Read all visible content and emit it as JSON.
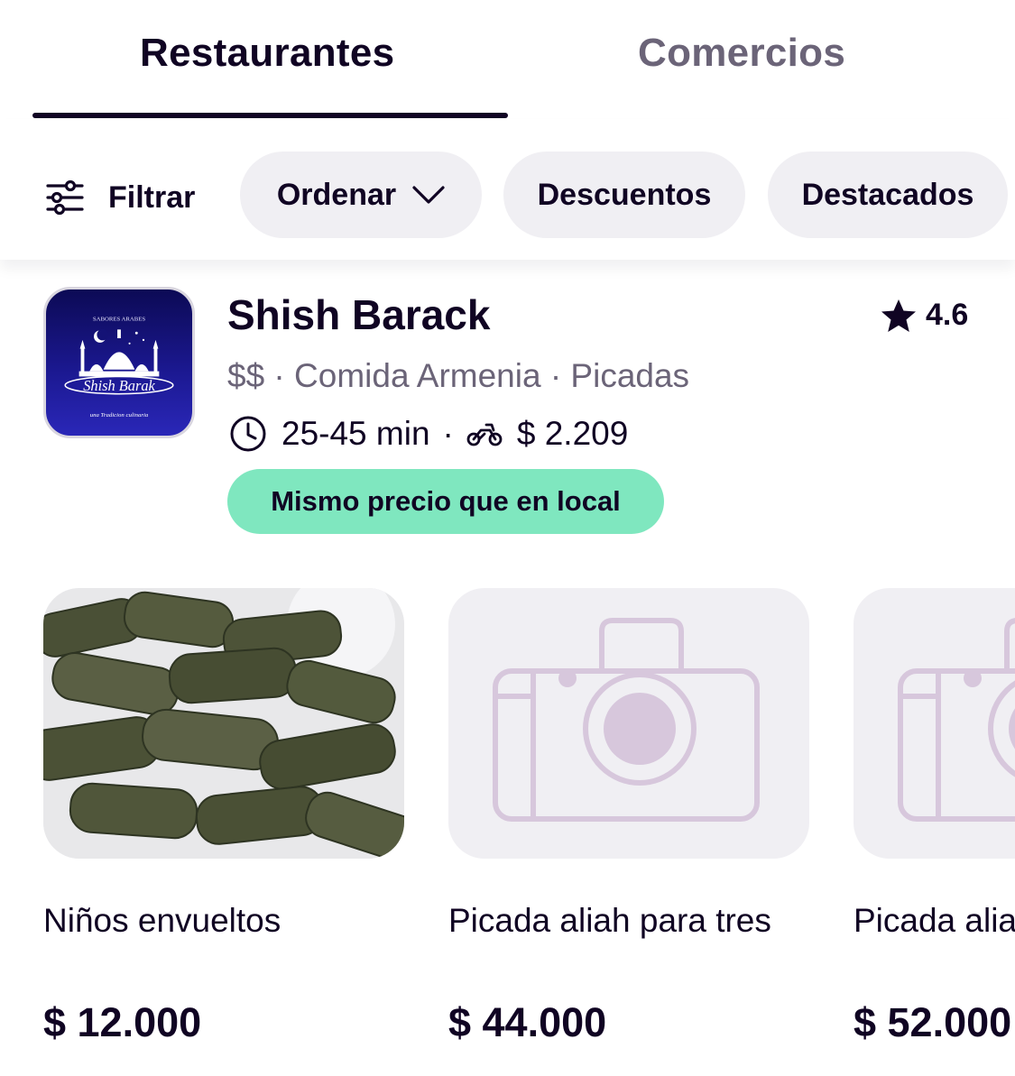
{
  "tabs": [
    {
      "label": "Restaurantes",
      "active": true
    },
    {
      "label": "Comercios",
      "active": false
    }
  ],
  "filters": {
    "filter_label": "Filtrar",
    "chips": [
      {
        "label": "Ordenar",
        "icon": "chevron-down-icon"
      },
      {
        "label": "Descuentos"
      },
      {
        "label": "Destacados"
      }
    ]
  },
  "restaurant": {
    "name": "Shish Barack",
    "rating": "4.6",
    "categories": "$$ · Comida Armenia · Picadas",
    "delivery_time": "25-45 min",
    "delivery_fee": "$ 2.209",
    "badge": "Mismo precio que en local",
    "badge_color": "#7fe7bf",
    "logo_text": {
      "top": "SABORES ARABES",
      "main": "Shish Barak",
      "bottom": "una Tradicion culinaria"
    }
  },
  "products": [
    {
      "name": "Niños envueltos",
      "price": "$ 12.000",
      "image": "food-photo"
    },
    {
      "name": "Picada aliah para tres",
      "price": "$ 44.000",
      "image": "camera-placeholder-icon"
    },
    {
      "name": "Picada aliah para cuatro",
      "price": "$ 52.000",
      "image": "camera-placeholder-icon"
    }
  ],
  "colors": {
    "text": "#100423",
    "muted": "#6b6478",
    "chip_bg": "#f0eff3",
    "placeholder_icon": "#d7c7dc"
  }
}
